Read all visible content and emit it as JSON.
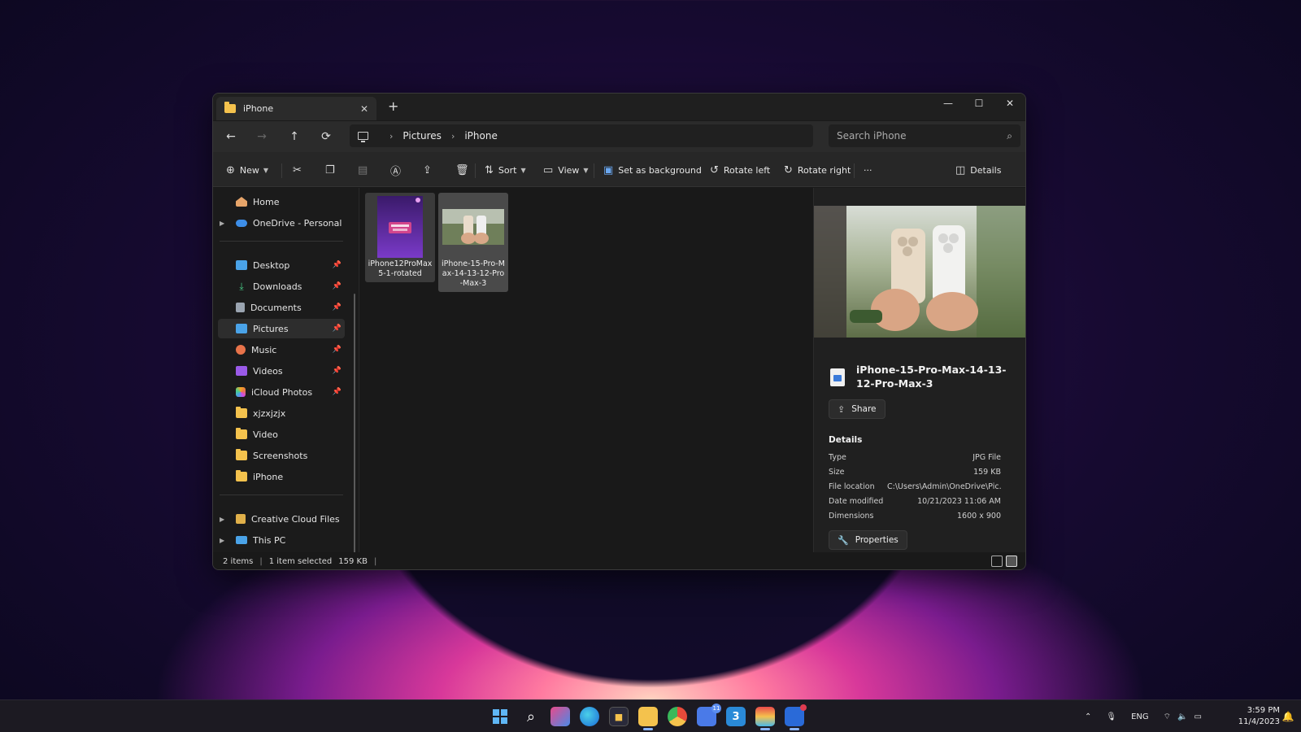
{
  "window": {
    "tab_title": "iPhone",
    "tab_close": "✕",
    "new_tab": "+",
    "controls": {
      "minimize": "—",
      "maximize": "☐",
      "close": "✕"
    }
  },
  "nav": {
    "back": "←",
    "forward": "→",
    "up": "↑",
    "refresh": "⟳",
    "breadcrumb": [
      "Pictures",
      "iPhone"
    ],
    "search_placeholder": "Search iPhone"
  },
  "toolbar": {
    "new_label": "New",
    "sort_label": "Sort",
    "view_label": "View",
    "set_bg_label": "Set as background",
    "rotate_left_label": "Rotate left",
    "rotate_right_label": "Rotate right",
    "more_label": "···",
    "details_label": "Details"
  },
  "sidebar": {
    "top": [
      {
        "label": "Home",
        "icon": "home-icon"
      },
      {
        "label": "OneDrive - Personal",
        "icon": "cloud-icon"
      }
    ],
    "quick": [
      {
        "label": "Desktop",
        "icon": "desktop-icon",
        "pinned": true
      },
      {
        "label": "Downloads",
        "icon": "download-icon",
        "pinned": true
      },
      {
        "label": "Documents",
        "icon": "documents-icon",
        "pinned": true
      },
      {
        "label": "Pictures",
        "icon": "pictures-icon",
        "pinned": true,
        "selected": true
      },
      {
        "label": "Music",
        "icon": "music-icon",
        "pinned": true
      },
      {
        "label": "Videos",
        "icon": "videos-icon",
        "pinned": true
      },
      {
        "label": "iCloud Photos",
        "icon": "icloud-photos-icon",
        "pinned": true
      },
      {
        "label": "xjzxjzjx",
        "icon": "folder-icon"
      },
      {
        "label": "Video",
        "icon": "folder-icon"
      },
      {
        "label": "Screenshots",
        "icon": "folder-icon"
      },
      {
        "label": "iPhone",
        "icon": "folder-icon"
      }
    ],
    "bottom": [
      {
        "label": "Creative Cloud Files",
        "icon": "creative-cloud-icon"
      },
      {
        "label": "This PC",
        "icon": "pc-icon"
      }
    ]
  },
  "files": [
    {
      "name": "iPhone12ProMax5-1-rotated",
      "state": "hover"
    },
    {
      "name": "iPhone-15-Pro-Max-14-13-12-Pro-Max-3",
      "state": "selected"
    }
  ],
  "preview": {
    "title": "iPhone-15-Pro-Max-14-13-12-Pro-Max-3",
    "share_label": "Share",
    "details_heading": "Details",
    "rows": [
      {
        "key": "Type",
        "value": "JPG File"
      },
      {
        "key": "Size",
        "value": "159 KB"
      },
      {
        "key": "File location",
        "value": "C:\\Users\\Admin\\OneDrive\\Pic..."
      },
      {
        "key": "Date modified",
        "value": "10/21/2023 11:06 AM"
      },
      {
        "key": "Dimensions",
        "value": "1600 x 900"
      }
    ],
    "properties_label": "Properties"
  },
  "status": {
    "items": "2 items",
    "selected": "1 item selected",
    "size": "159 KB"
  },
  "taskbar": {
    "badge_count": "11",
    "lang": "ENG",
    "time": "3:59 PM",
    "date": "11/4/2023"
  }
}
